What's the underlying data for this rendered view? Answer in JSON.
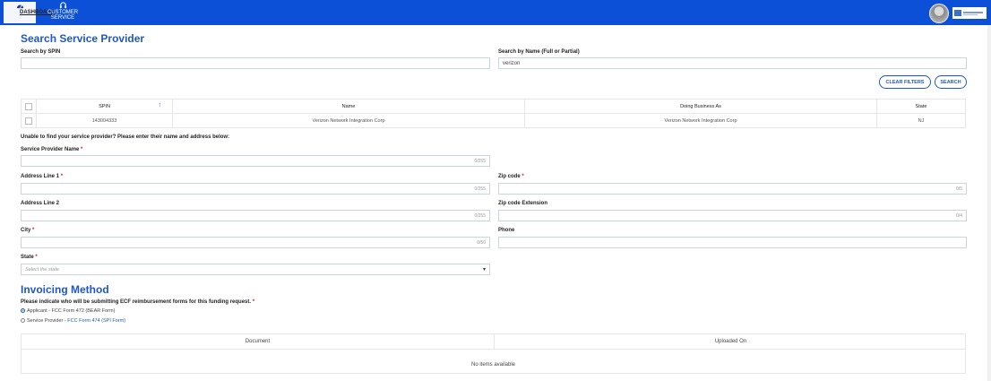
{
  "nav": {
    "dashboard": "DASHBOARD",
    "customer_service": "CUSTOMER SERVICE"
  },
  "search": {
    "title": "Search Service Provider",
    "spin_label": "Search by SPIN",
    "spin_value": "",
    "name_label": "Search by Name (Full or Partial)",
    "name_value": "verizon",
    "clear_filters": "CLEAR FILTERS",
    "search_button": "SEARCH"
  },
  "results": {
    "columns": [
      "SPIN",
      "Name",
      "Doing Business As",
      "State"
    ],
    "sort_indicator": "↑",
    "rows": [
      {
        "spin": "143004333",
        "name": "Verizon Network Integration Corp",
        "dba": "Verizon Network Integration Corp",
        "state": "NJ"
      }
    ]
  },
  "manual": {
    "prompt": "Unable to find your service provider? Please enter their name and address below:",
    "required_mark": "*",
    "sp_name_label": "Service Provider Name",
    "sp_name_count": "0/255",
    "addr1_label": "Address Line 1",
    "addr1_count": "0/255",
    "zip_label": "Zip code",
    "zip_count": "0/5",
    "addr2_label": "Address Line 2",
    "addr2_count": "0/255",
    "zip_ext_label": "Zip code Extension",
    "zip_ext_count": "0/4",
    "city_label": "City",
    "city_count": "0/50",
    "phone_label": "Phone",
    "state_label": "State",
    "state_placeholder": "Select the state"
  },
  "invoicing": {
    "title": "Invoicing Method",
    "question": "Please indicate who will be submitting ECF reimbursement forms for this funding request.",
    "option_applicant": "Applicant - FCC Form 472 (BEAR Form)",
    "option_sp_prefix": "Service Provider - ",
    "option_sp_link": "FCC Form 474 (SPI Form)",
    "selected": "applicant"
  },
  "documents": {
    "columns": [
      "Document",
      "Uploaded On"
    ],
    "empty_text": "No items available"
  },
  "colors": {
    "topbar": "#0b50d6",
    "accent": "#1f57c8"
  }
}
